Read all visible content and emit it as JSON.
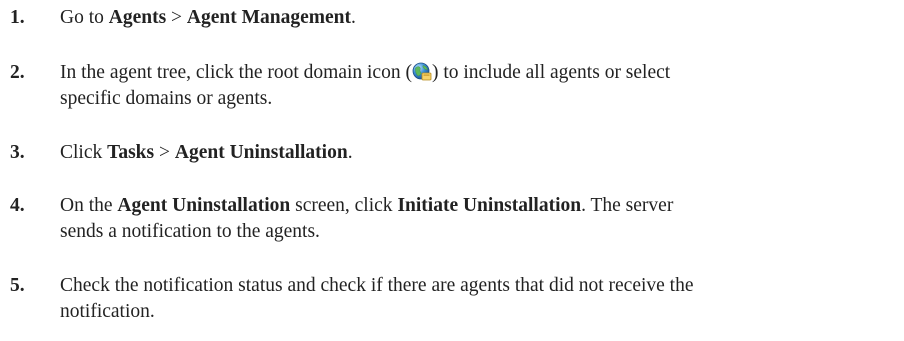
{
  "steps": [
    {
      "number": "1.",
      "t1": "Go to ",
      "b1": "Agents",
      "t2": " > ",
      "b2": "Agent Management",
      "t3": "."
    },
    {
      "number": "2.",
      "t1": "In the agent tree, click the root domain icon (",
      "icon": "root-domain-globe-icon",
      "t2": ") to include all agents or select",
      "line2": "specific domains or agents."
    },
    {
      "number": "3.",
      "t1": "Click ",
      "b1": "Tasks",
      "t2": " > ",
      "b2": "Agent Uninstallation",
      "t3": "."
    },
    {
      "number": "4.",
      "t1": "On the ",
      "b1": "Agent Uninstallation",
      "t2": " screen, click ",
      "b2": "Initiate Uninstallation",
      "t3": ". The server",
      "line2": "sends a notification to the agents."
    },
    {
      "number": "5.",
      "line1": "Check the notification status and check if there are agents that did not receive the",
      "line2": "notification."
    }
  ]
}
